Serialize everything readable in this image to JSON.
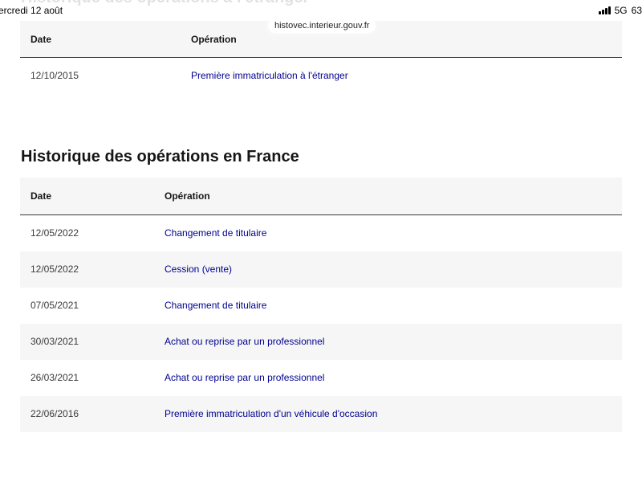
{
  "status_bar": {
    "time": "ercredi 12 août",
    "network": "5G",
    "battery": "63"
  },
  "browser": {
    "url": "histovec.interieur.gouv.fr"
  },
  "foreign_section": {
    "title": "Historique des opérations à l'étranger",
    "columns": {
      "date": "Date",
      "operation": "Opération"
    },
    "rows": [
      {
        "date": "12/10/2015",
        "operation": "Première immatriculation à l'étranger"
      }
    ]
  },
  "france_section": {
    "title": "Historique des opérations en France",
    "columns": {
      "date": "Date",
      "operation": "Opération"
    },
    "rows": [
      {
        "date": "12/05/2022",
        "operation": "Changement de titulaire"
      },
      {
        "date": "12/05/2022",
        "operation": "Cession (vente)"
      },
      {
        "date": "07/05/2021",
        "operation": "Changement de titulaire"
      },
      {
        "date": "30/03/2021",
        "operation": "Achat ou reprise par un professionnel"
      },
      {
        "date": "26/03/2021",
        "operation": "Achat ou reprise par un professionnel"
      },
      {
        "date": "22/06/2016",
        "operation": "Première immatriculation d'un véhicule d'occasion"
      }
    ]
  }
}
